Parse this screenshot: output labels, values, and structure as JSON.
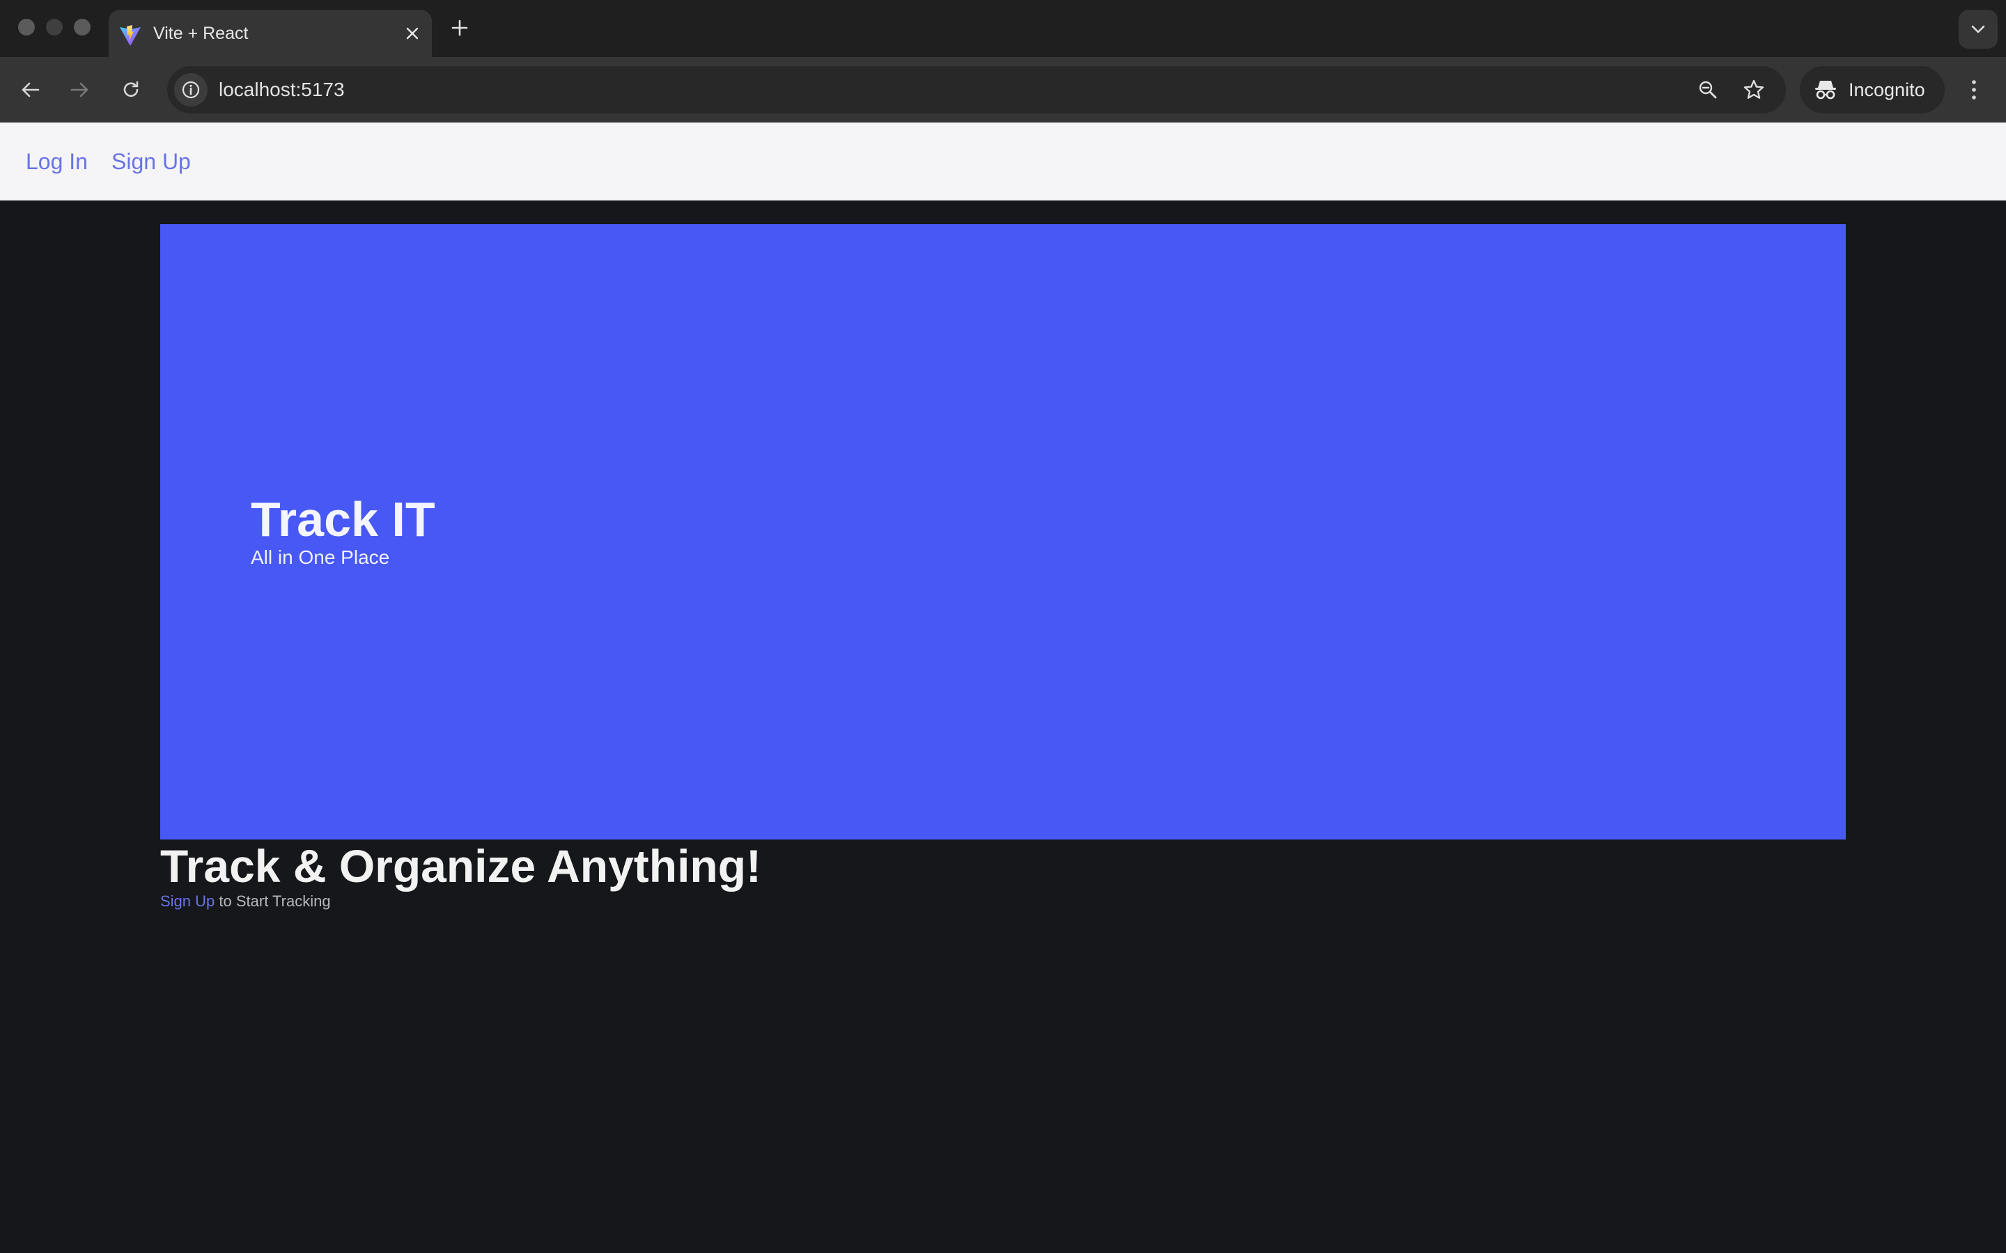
{
  "browser": {
    "tab": {
      "title": "Vite + React",
      "favicon": "vite-logo-icon"
    },
    "address_bar": {
      "url": "localhost:5173"
    },
    "profile": {
      "label": "Incognito"
    }
  },
  "nav": {
    "login_label": "Log In",
    "signup_label": "Sign Up"
  },
  "hero": {
    "title": "Track IT",
    "subtitle": "All in One Place",
    "background_color": "#4758f5"
  },
  "main": {
    "headline": "Track & Organize Anything!",
    "cta_link": "Sign Up",
    "cta_text": " to Start Tracking"
  },
  "colors": {
    "link": "#6873e6",
    "page_background": "#15171b",
    "nav_background": "#f5f5f7"
  }
}
